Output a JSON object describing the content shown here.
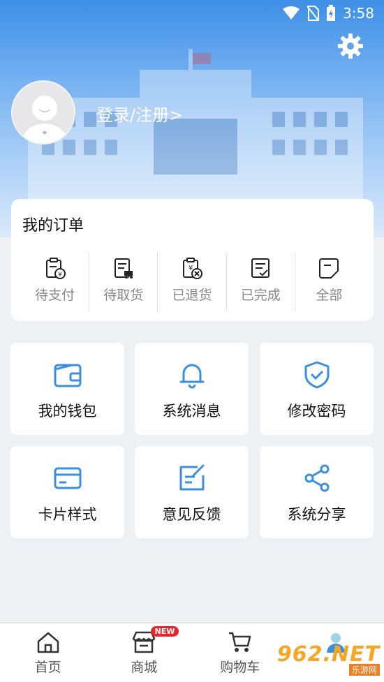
{
  "status_bar": {
    "time": "3:58"
  },
  "header": {
    "login_label": "登录/注册>"
  },
  "orders": {
    "title": "我的订单",
    "items": [
      {
        "label": "待支付",
        "icon": "pay-pending-icon"
      },
      {
        "label": "待取货",
        "icon": "pickup-icon"
      },
      {
        "label": "已退货",
        "icon": "returned-icon"
      },
      {
        "label": "已完成",
        "icon": "completed-icon"
      },
      {
        "label": "全部",
        "icon": "all-orders-icon"
      }
    ]
  },
  "tiles": [
    {
      "label": "我的钱包",
      "icon": "wallet-icon"
    },
    {
      "label": "系统消息",
      "icon": "bell-icon"
    },
    {
      "label": "修改密码",
      "icon": "shield-icon"
    },
    {
      "label": "卡片样式",
      "icon": "card-icon"
    },
    {
      "label": "意见反馈",
      "icon": "feedback-icon"
    },
    {
      "label": "系统分享",
      "icon": "share-icon"
    }
  ],
  "bottom_nav": {
    "items": [
      {
        "label": "首页",
        "icon": "home-icon"
      },
      {
        "label": "商城",
        "icon": "store-icon",
        "badge": "NEW"
      },
      {
        "label": "购物车",
        "icon": "cart-icon"
      },
      {
        "label": "",
        "icon": "profile-icon"
      }
    ]
  },
  "watermark": {
    "brand": "962.NET",
    "sub": "乐游网"
  },
  "colors": {
    "accent": "#3b8fe0",
    "badge": "#e8242c"
  }
}
